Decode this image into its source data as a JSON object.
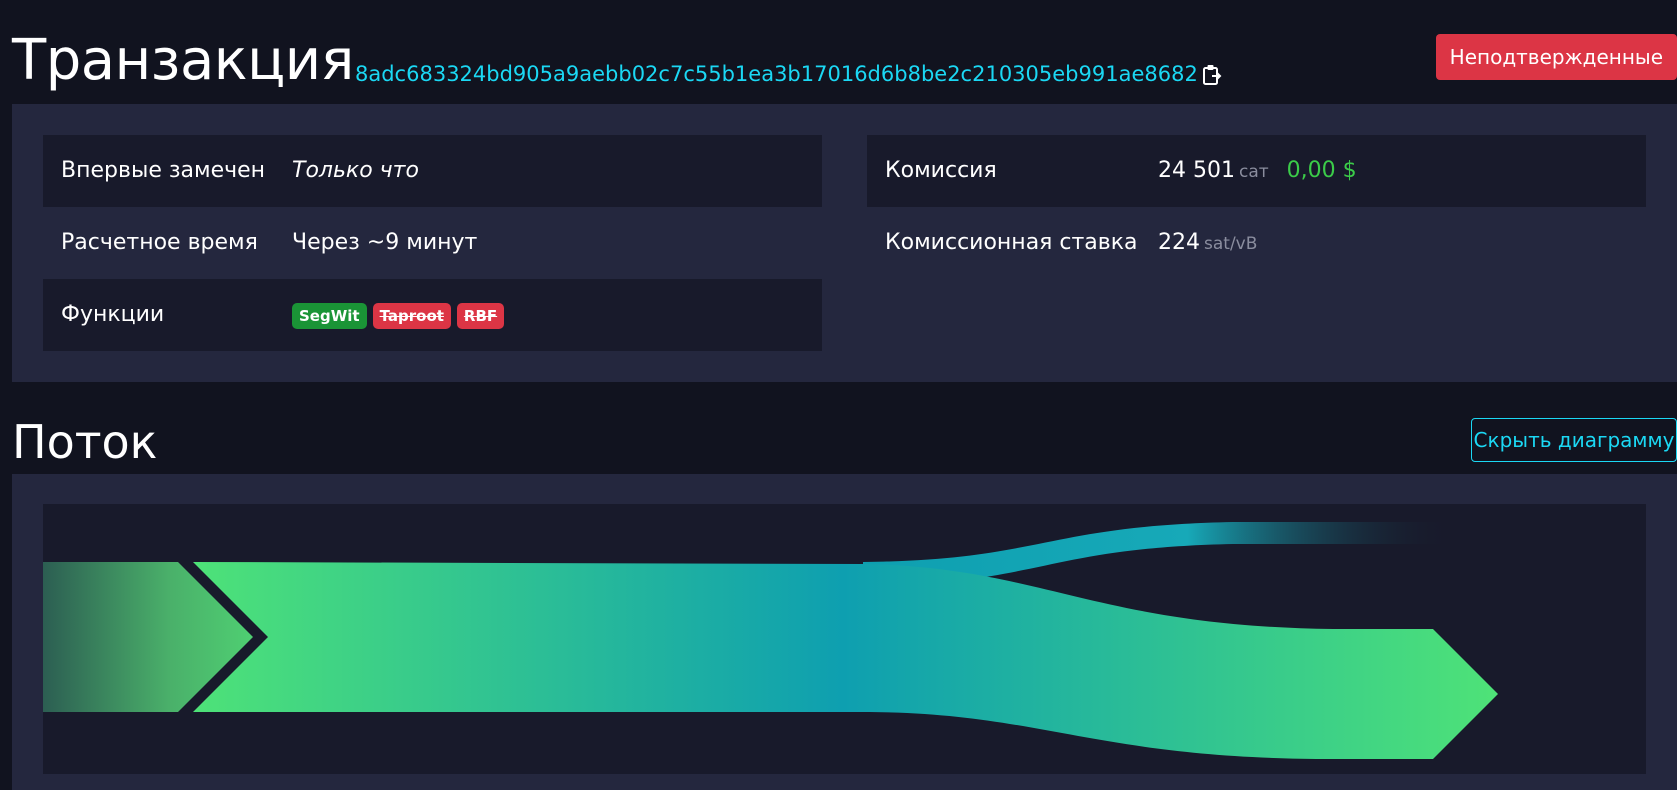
{
  "header": {
    "title": "Транзакция",
    "txid": "8adc683324bd905a9aebb02c7c55b1ea3b17016d6b8be2c210305eb991ae8682",
    "copy_icon": "clipboard-icon",
    "status": "Неподтвержденные"
  },
  "details": {
    "first_seen_label": "Впервые замечен",
    "first_seen_value": "Только что",
    "eta_label": "Расчетное время",
    "eta_value": "Через ~9 минут",
    "features_label": "Функции",
    "features": [
      {
        "label": "SegWit",
        "enabled": true
      },
      {
        "label": "Taproot",
        "enabled": false
      },
      {
        "label": "RBF",
        "enabled": false
      }
    ],
    "fee_label": "Комиссия",
    "fee_value": "24 501",
    "fee_unit": "сат",
    "fee_usd": "0,00 $",
    "fee_rate_label": "Комиссионная ставка",
    "fee_rate_value": "224",
    "fee_rate_unit": "sat/vB"
  },
  "flow": {
    "title": "Поток",
    "hide_button": "Скрыть диаграмму"
  },
  "colors": {
    "background": "#11131f",
    "panel": "#24273e",
    "stripe": "#181a2b",
    "accent": "#1bd8f4",
    "danger": "#dc3545",
    "success": "#3bcc49",
    "flow_green": "#4fe377",
    "flow_teal": "#0e9fb0"
  }
}
